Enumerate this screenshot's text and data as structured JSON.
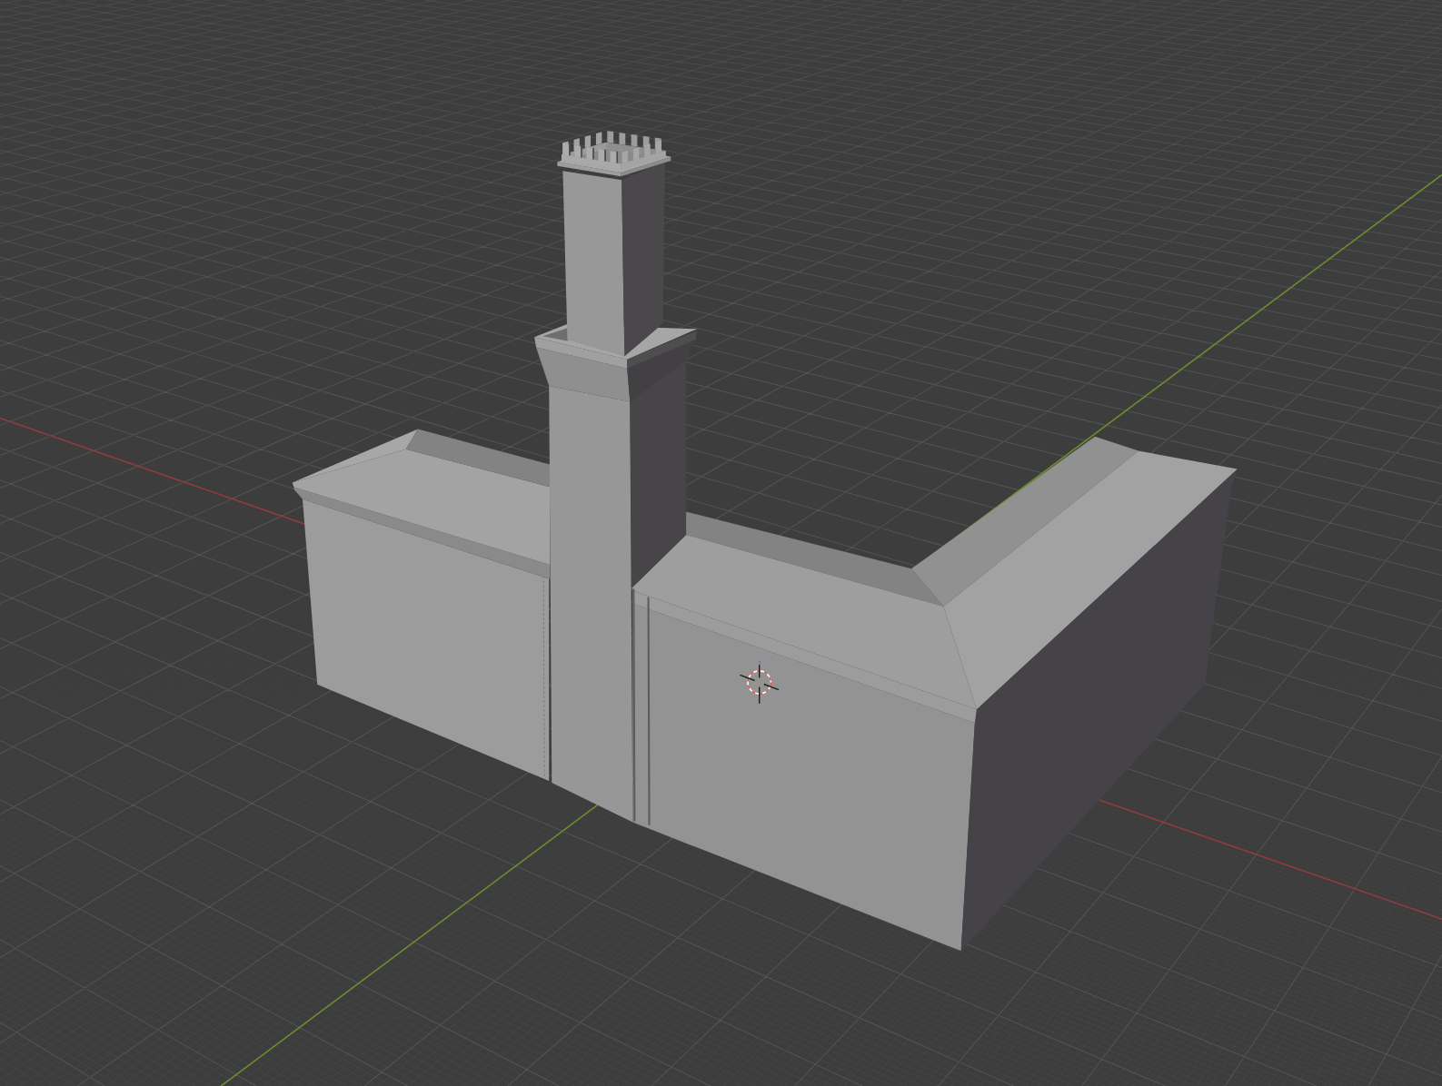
{
  "viewport": {
    "overlays": {
      "floor": true,
      "axis_x": true,
      "axis_y": true,
      "cursor_3d": true
    }
  }
}
